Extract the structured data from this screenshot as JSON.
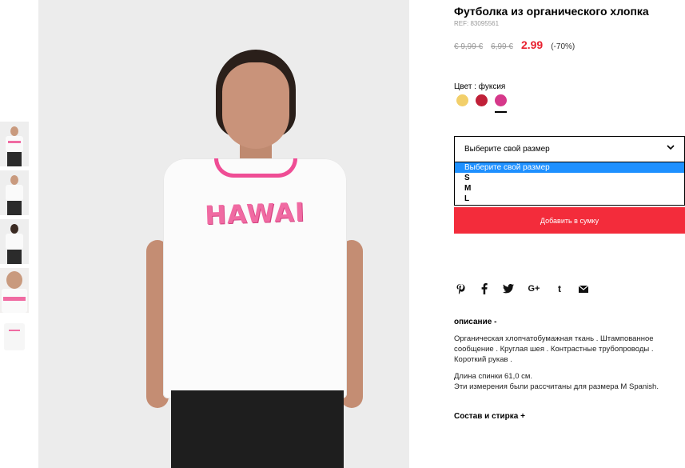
{
  "product": {
    "title": "Футболка из органического хлопка",
    "ref": "REF: 83095561",
    "prices": {
      "old1": "€ 9,99 €",
      "old2": "6,99 €",
      "current": "2.99",
      "discount": "(-70%)"
    }
  },
  "color": {
    "label": "Цвет : фуксия",
    "swatches": [
      {
        "name": "yellow",
        "hex": "#f2cf6a"
      },
      {
        "name": "red",
        "hex": "#c02038"
      },
      {
        "name": "fuchsia",
        "hex": "#d6388a",
        "selected": true
      }
    ]
  },
  "size": {
    "placeholder": "Выберите свой размер",
    "options": [
      "Выберите свой размер",
      "S",
      "M",
      "L"
    ],
    "selected_index": 0
  },
  "cart": {
    "add_label": "Добавить в сумку"
  },
  "social": {
    "icons": [
      "pinterest-icon",
      "facebook-icon",
      "twitter-icon",
      "google-plus-icon",
      "tumblr-icon",
      "email-icon"
    ]
  },
  "description": {
    "heading": "описание -",
    "text": "Органическая хлопчатобумажная ткань . Штампованное сообщение . Круглая шея . Контрастные трубопроводы . Короткий рукав .",
    "length_line1": "Длина спинки 61,0 см.",
    "length_line2": "Эти измерения были рассчитаны для размера M Spanish."
  },
  "care": {
    "heading": "Состав и стирка +"
  },
  "image": {
    "shirt_print": "HAWAI"
  },
  "colors": {
    "accent_red": "#f32c3b",
    "price_red": "#e8202e",
    "highlight_blue": "#1e90ff",
    "print_pink": "#f06aa2"
  }
}
